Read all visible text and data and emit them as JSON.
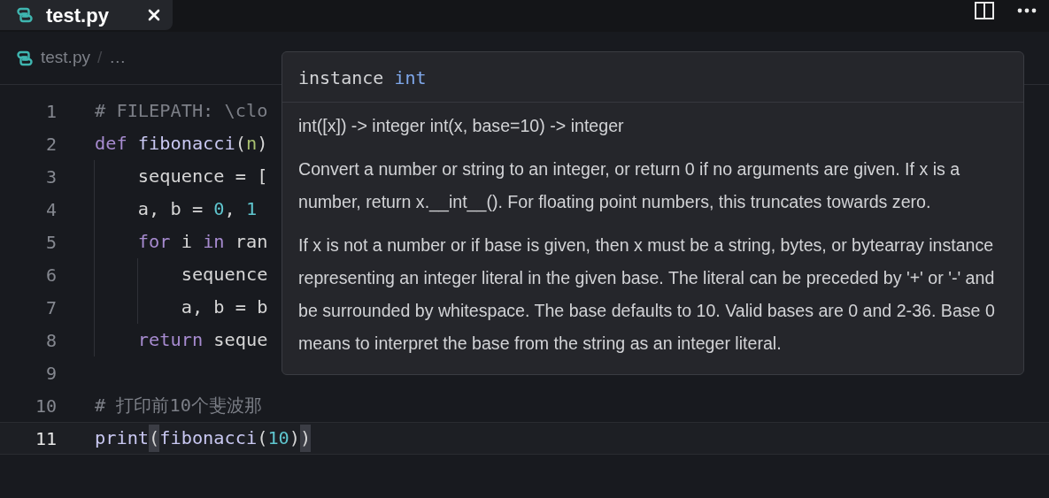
{
  "tabs": [
    {
      "label": "test.py",
      "selected": true
    }
  ],
  "breadcrumb": {
    "file": "test.py",
    "separator": "/",
    "rest": "…"
  },
  "editor": {
    "lines": [
      {
        "number": "1",
        "current": false,
        "tokens": [
          {
            "kind": "comment",
            "text": "# FILEPATH: \\clo"
          }
        ]
      },
      {
        "number": "2",
        "current": false,
        "tokens": [
          {
            "kind": "keyword",
            "text": "def "
          },
          {
            "kind": "function",
            "text": "fibonacci"
          },
          {
            "kind": "plain",
            "text": "("
          },
          {
            "kind": "param",
            "text": "n"
          },
          {
            "kind": "plain",
            "text": ")"
          }
        ]
      },
      {
        "number": "3",
        "current": false,
        "tokens": [
          {
            "kind": "plain",
            "text": "    sequence = ["
          }
        ]
      },
      {
        "number": "4",
        "current": false,
        "tokens": [
          {
            "kind": "plain",
            "text": "    a, b = "
          },
          {
            "kind": "number",
            "text": "0"
          },
          {
            "kind": "plain",
            "text": ", "
          },
          {
            "kind": "number",
            "text": "1"
          }
        ]
      },
      {
        "number": "5",
        "current": false,
        "tokens": [
          {
            "kind": "keyword",
            "text": "    for"
          },
          {
            "kind": "plain",
            "text": " i "
          },
          {
            "kind": "keyword",
            "text": "in"
          },
          {
            "kind": "plain",
            "text": " ran"
          }
        ]
      },
      {
        "number": "6",
        "current": false,
        "tokens": [
          {
            "kind": "plain",
            "text": "        sequence"
          }
        ]
      },
      {
        "number": "7",
        "current": false,
        "tokens": [
          {
            "kind": "plain",
            "text": "        a, b = b"
          }
        ]
      },
      {
        "number": "8",
        "current": false,
        "tokens": [
          {
            "kind": "keyword",
            "text": "    return"
          },
          {
            "kind": "plain",
            "text": " seque"
          }
        ]
      },
      {
        "number": "9",
        "current": false
      },
      {
        "number": "10",
        "current": false,
        "tokens": [
          {
            "kind": "comment",
            "text": "# 打印前10个斐波那"
          }
        ]
      },
      {
        "number": "11",
        "current": true,
        "tokens": [
          {
            "kind": "function",
            "text": "print"
          },
          {
            "kind": "bracket",
            "text": "("
          },
          {
            "kind": "function",
            "text": "fibonacci"
          },
          {
            "kind": "plain",
            "text": "("
          },
          {
            "kind": "number",
            "text": "10"
          },
          {
            "kind": "plain",
            "text": ")"
          },
          {
            "kind": "bracket",
            "text": ")"
          }
        ]
      }
    ]
  },
  "hover": {
    "heading": "instance",
    "type": "int",
    "signature": "int([x]) -> integer int(x, base=10) -> integer",
    "paragraphs": [
      "Convert a number or string to an integer, or return 0 if no arguments are given. If x is a number, return x.__int__(). For floating point numbers, this truncates towards zero.",
      "If x is not a number or if base is given, then x must be a string, bytes, or bytearray instance representing an integer literal in the given base. The literal can be preceded by '+' or '-' and be surrounded by whitespace. The base defaults to 10. Valid bases are 0 and 2-36. Base 0 means to interpret the base from the string as an integer literal."
    ]
  }
}
